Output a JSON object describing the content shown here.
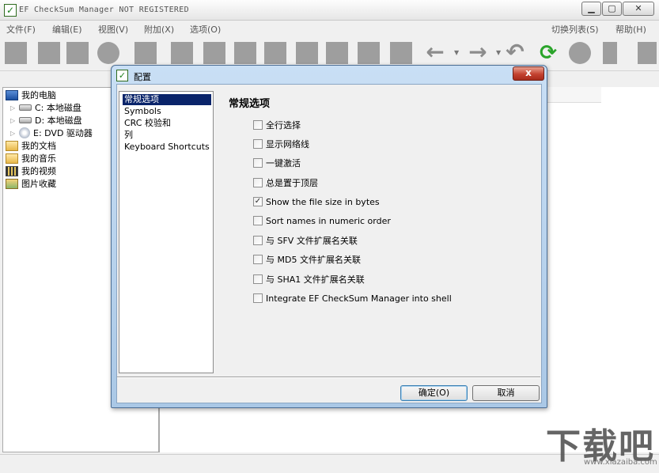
{
  "window": {
    "title": "EF CheckSum Manager NOT REGISTERED",
    "controls": {
      "minimize": "▁",
      "maximize": "▢",
      "close": "✕"
    }
  },
  "menubar": {
    "left": [
      "文件(F)",
      "编辑(E)",
      "视图(V)",
      "附加(X)",
      "选项(O)"
    ],
    "right": [
      "切换列表(S)",
      "帮助(H)"
    ]
  },
  "toolbar": {
    "icons": [
      "new-file-icon",
      "open-file-icon",
      "save-icon",
      "circle-icon",
      "folder-icon",
      "copy-icon",
      "eraser-icon",
      "document-icon",
      "check-doc-icon",
      "doc-plus-icon",
      "doc-minus-icon",
      "filter-icon",
      "trash-icon",
      "back-arrow-icon",
      "forward-arrow-icon",
      "undo-icon",
      "refresh-icon",
      "stop-icon",
      "lightning-icon",
      "delete-icon"
    ],
    "refresh_glyph": "⟳",
    "back_glyph": "←",
    "forward_glyph": "→",
    "undo_glyph": "↶",
    "dropdown_glyph": "▼"
  },
  "tree": {
    "expander": "▷",
    "items": [
      {
        "label": "我的电脑",
        "icon": "computer-icon"
      },
      {
        "label": "C: 本地磁盘",
        "icon": "drive-icon"
      },
      {
        "label": "D: 本地磁盘",
        "icon": "drive-icon"
      },
      {
        "label": "E: DVD 驱动器",
        "icon": "dvd-icon"
      },
      {
        "label": "我的文档",
        "icon": "folder-icon"
      },
      {
        "label": "我的音乐",
        "icon": "folder-icon"
      },
      {
        "label": "我的视频",
        "icon": "film-icon"
      },
      {
        "label": "图片收藏",
        "icon": "picture-icon"
      }
    ]
  },
  "dialog": {
    "title": "配置",
    "close": "x",
    "categories": [
      {
        "label": "常规选项",
        "selected": true
      },
      {
        "label": "Symbols",
        "selected": false
      },
      {
        "label": "CRC 校验和",
        "selected": false
      },
      {
        "label": "列",
        "selected": false
      },
      {
        "label": "Keyboard Shortcuts",
        "selected": false
      }
    ],
    "section_title": "常规选项",
    "options": [
      {
        "label": "全行选择",
        "checked": false
      },
      {
        "label": "显示网络线",
        "checked": false
      },
      {
        "label": "一键激活",
        "checked": false
      },
      {
        "label": "总是置于顶层",
        "checked": false
      },
      {
        "label": "Show the file size in bytes",
        "checked": true
      },
      {
        "label": "Sort names in numeric order",
        "checked": false
      },
      {
        "label": "与 SFV 文件扩展名关联",
        "checked": false
      },
      {
        "label": "与 MD5 文件扩展名关联",
        "checked": false
      },
      {
        "label": "与 SHA1 文件扩展名关联",
        "checked": false
      },
      {
        "label": "Integrate EF CheckSum Manager into shell",
        "checked": false
      }
    ],
    "check_mark": "✓",
    "ok_label": "确定(O)",
    "cancel_label": "取消"
  },
  "watermark": {
    "brand": "下载吧",
    "url": "www.xiazaiba.com"
  }
}
